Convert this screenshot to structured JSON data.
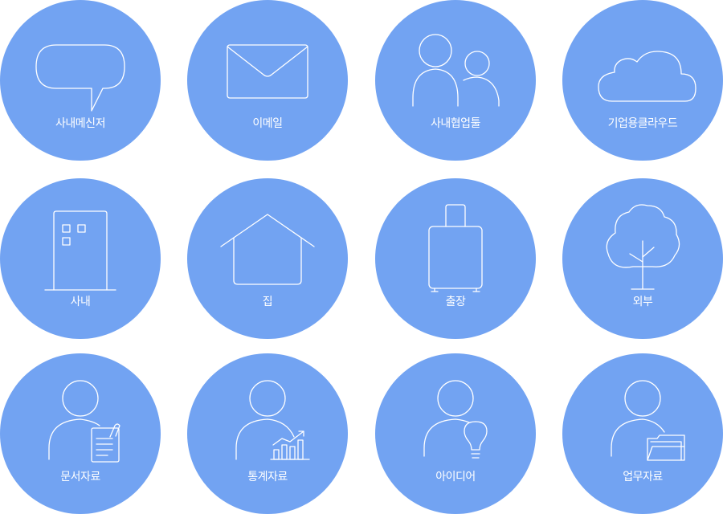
{
  "background": "#ffffff",
  "tile_color": "#72a3f2",
  "icon_color": "#ffffff",
  "tiles": [
    {
      "label": "사내메신저",
      "icon": "speech-bubble-icon"
    },
    {
      "label": "이메일",
      "icon": "envelope-icon"
    },
    {
      "label": "사내협업툴",
      "icon": "two-people-icon"
    },
    {
      "label": "기업용클라우드",
      "icon": "cloud-icon"
    },
    {
      "label": "사내",
      "icon": "office-building-icon"
    },
    {
      "label": "집",
      "icon": "house-icon"
    },
    {
      "label": "출장",
      "icon": "suitcase-icon"
    },
    {
      "label": "외부",
      "icon": "tree-icon"
    },
    {
      "label": "문서자료",
      "icon": "person-document-icon"
    },
    {
      "label": "통계자료",
      "icon": "person-chart-icon"
    },
    {
      "label": "아이디어",
      "icon": "person-lightbulb-icon"
    },
    {
      "label": "업무자료",
      "icon": "person-folder-icon"
    }
  ]
}
